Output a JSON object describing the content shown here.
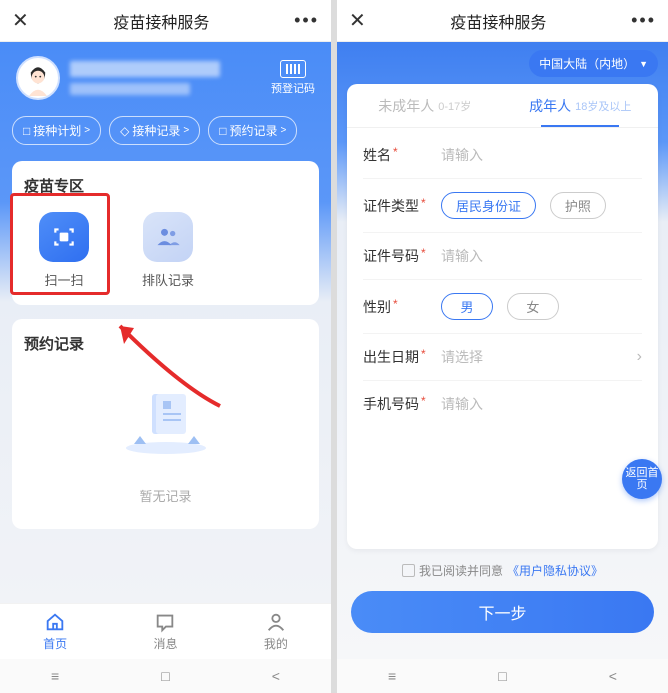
{
  "left": {
    "nav": {
      "title": "疫苗接种服务"
    },
    "barcode_label": "预登记码",
    "chips": [
      {
        "icon": "□",
        "label": "接种计划",
        "arr": ">"
      },
      {
        "icon": "◇",
        "label": "接种记录",
        "arr": ">"
      },
      {
        "icon": "□",
        "label": "预约记录",
        "arr": ">"
      }
    ],
    "zone": {
      "title": "疫苗专区",
      "tools": {
        "scan": "扫一扫",
        "queue": "排队记录"
      }
    },
    "records": {
      "title": "预约记录",
      "empty": "暂无记录"
    },
    "tabs": {
      "home": "首页",
      "msg": "消息",
      "me": "我的"
    },
    "android": {
      "menu": "≡",
      "square": "□",
      "back": "<"
    }
  },
  "right": {
    "nav": {
      "title": "疫苗接种服务"
    },
    "region": "中国大陆（内地）",
    "tabs": {
      "minor_main": "未成年人",
      "minor_sub": "0-17岁",
      "adult_main": "成年人",
      "adult_sub": "18岁及以上"
    },
    "form": {
      "name_label": "姓名",
      "name_ph": "请输入",
      "idtype_label": "证件类型",
      "idtype_opt1": "居民身份证",
      "idtype_opt2": "护照",
      "idno_label": "证件号码",
      "idno_ph": "请输入",
      "gender_label": "性别",
      "gender_m": "男",
      "gender_f": "女",
      "dob_label": "出生日期",
      "dob_ph": "请选择",
      "phone_label": "手机号码",
      "phone_ph": "请输入"
    },
    "gohome": "返回首页",
    "agree_pre": "我已阅读并同意",
    "agree_link": "《用户隐私协议》",
    "next": "下一步",
    "android": {
      "menu": "≡",
      "square": "□",
      "back": "<"
    }
  }
}
